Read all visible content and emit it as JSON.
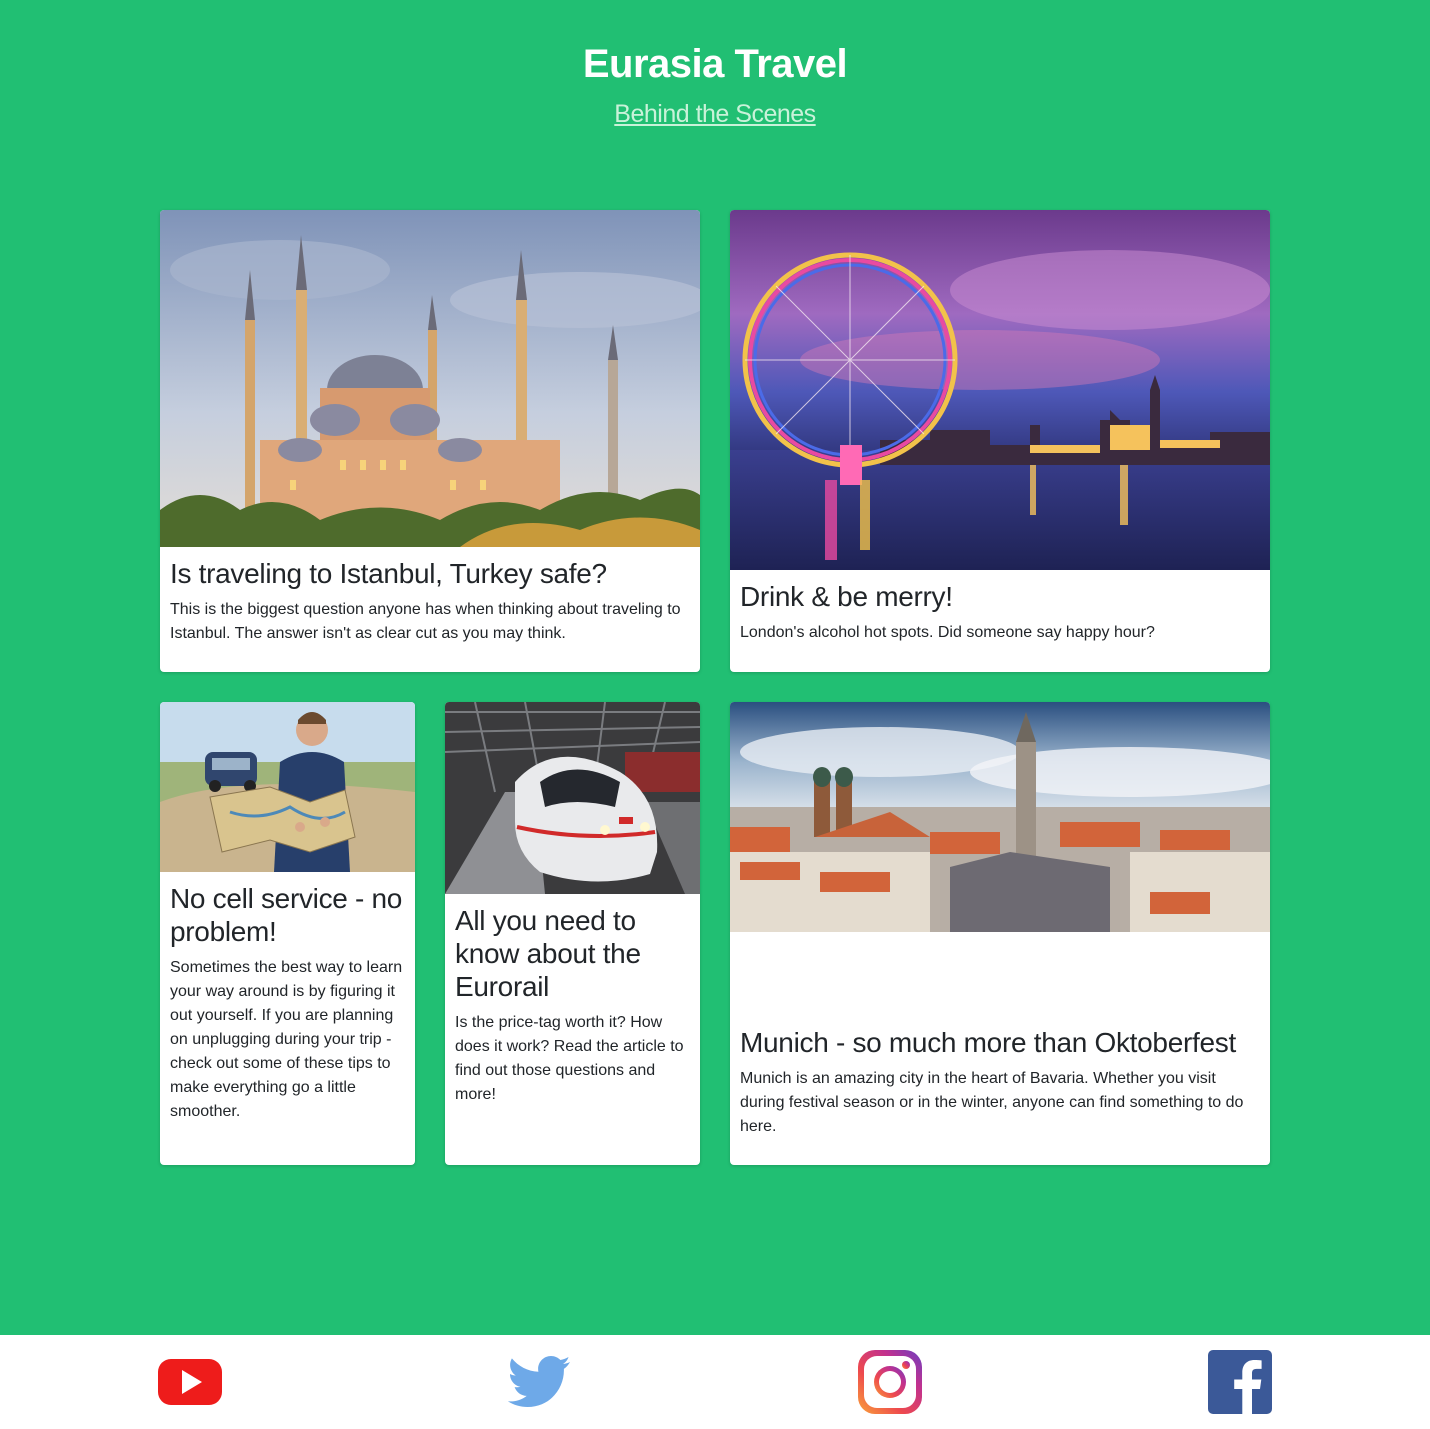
{
  "header": {
    "title": "Eurasia Travel",
    "link": "Behind the Scenes"
  },
  "cards": [
    {
      "title": "Is traveling to Istanbul, Turkey safe?",
      "text": "This is the biggest question anyone has when thinking about traveling to Istanbul. The answer isn't as clear cut as you may think."
    },
    {
      "title": "Drink & be merry!",
      "text": "London's alcohol hot spots. Did someone say happy hour?"
    },
    {
      "title": "No cell service - no problem!",
      "text": "Sometimes the best way to learn your way around is by figuring it out yourself. If you are planning on unplugging during your trip - check out some of these tips to make everything go a little smoother."
    },
    {
      "title": "All you need to know about the Eurorail",
      "text": "Is the price-tag worth it? How does it work? Read the article to find out those questions and more!"
    },
    {
      "title": "Munich - so much more than Oktoberfest",
      "text": "Munich is an amazing city in the heart of Bavaria. Whether you visit during festival season or in the winter, anyone can find something to do here."
    }
  ],
  "footer": {
    "icons": [
      "youtube-icon",
      "twitter-icon",
      "instagram-icon",
      "facebook-icon"
    ]
  },
  "colors": {
    "background": "#21bf73",
    "youtube": "#ee1c1b",
    "twitter": "#6ea9e8",
    "facebook": "#3b5998"
  }
}
